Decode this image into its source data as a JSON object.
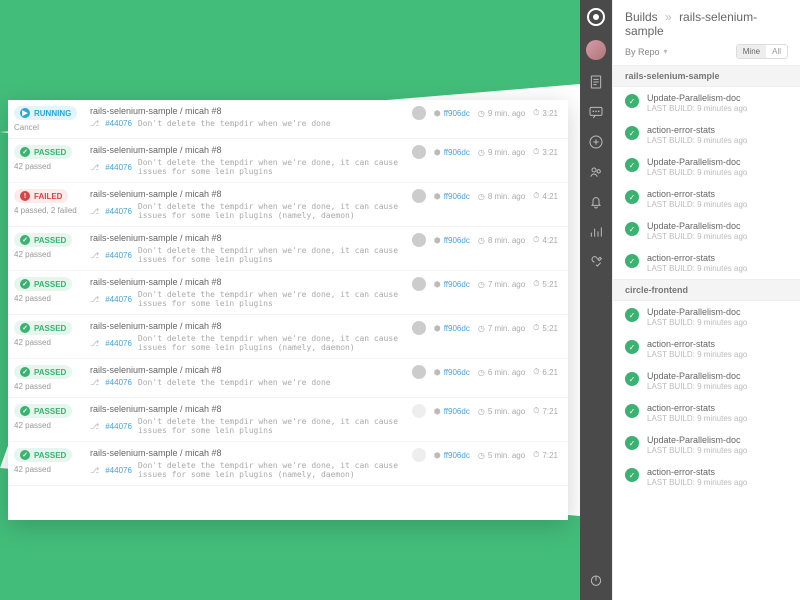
{
  "breadcrumb": {
    "root": "Builds",
    "repo": "rails-selenium-sample"
  },
  "filter": {
    "byRepo": "By Repo",
    "mine": "Mine",
    "all": "All"
  },
  "panel": {
    "groups": [
      {
        "name": "rails-selenium-sample",
        "items": [
          {
            "name": "Update-Parallelism-doc",
            "meta": "LAST BUILD: 9 minutes ago"
          },
          {
            "name": "action-error-stats",
            "meta": "LAST BUILD: 9 minutes ago"
          },
          {
            "name": "Update-Parallelism-doc",
            "meta": "LAST BUILD: 9 minutes ago"
          },
          {
            "name": "action-error-stats",
            "meta": "LAST BUILD: 9 minutes ago"
          },
          {
            "name": "Update-Parallelism-doc",
            "meta": "LAST BUILD: 9 minutes ago"
          },
          {
            "name": "action-error-stats",
            "meta": "LAST BUILD: 9 minutes ago"
          }
        ]
      },
      {
        "name": "circle-frontend",
        "items": [
          {
            "name": "Update-Parallelism-doc",
            "meta": "LAST BUILD: 9 minutes ago"
          },
          {
            "name": "action-error-stats",
            "meta": "LAST BUILD: 9 minutes ago"
          },
          {
            "name": "Update-Parallelism-doc",
            "meta": "LAST BUILD: 9 minutes ago"
          },
          {
            "name": "action-error-stats",
            "meta": "LAST BUILD: 9 minutes ago"
          },
          {
            "name": "Update-Parallelism-doc",
            "meta": "LAST BUILD: 9 minutes ago"
          },
          {
            "name": "action-error-stats",
            "meta": "LAST BUILD: 9 minutes ago"
          }
        ]
      }
    ]
  },
  "builds": [
    {
      "status": "RUNNING",
      "statusKind": "running",
      "sub": "Cancel",
      "subKind": "neutral",
      "title": "rails-selenium-sample / micah  #8",
      "commitId": "#44076",
      "commitMsg": "Don't delete the tempdir when we're done",
      "hash": "ff906dc",
      "time": "9 min. ago",
      "count": "3:21",
      "avatar": true
    },
    {
      "status": "PASSED",
      "statusKind": "passed",
      "sub": "42 passed",
      "title": "rails-selenium-sample / micah  #8",
      "commitId": "#44076",
      "commitMsg": "Don't delete the tempdir when we're done, it can cause issues for some lein plugins",
      "hash": "ff906dc",
      "time": "9 min. ago",
      "count": "3:21",
      "avatar": true
    },
    {
      "status": "FAILED",
      "statusKind": "failed",
      "sub": "4 passed, 2 failed",
      "title": "rails-selenium-sample / micah  #8",
      "commitId": "#44076",
      "commitMsg": "Don't delete the tempdir when we're done, it can cause issues for some lein plugins (namely, daemon)",
      "hash": "ff906dc",
      "time": "8 min. ago",
      "count": "4:21",
      "avatar": true
    },
    {
      "status": "PASSED",
      "statusKind": "passed",
      "sub": "42 passed",
      "title": "rails-selenium-sample / micah  #8",
      "commitId": "#44076",
      "commitMsg": "Don't delete the tempdir when we're done, it can cause issues for some lein plugins",
      "hash": "ff906dc",
      "time": "8 min. ago",
      "count": "4:21",
      "avatar": true
    },
    {
      "status": "PASSED",
      "statusKind": "passed",
      "sub": "42 passed",
      "title": "rails-selenium-sample / micah  #8",
      "commitId": "#44076",
      "commitMsg": "Don't delete the tempdir when we're done, it can cause issues for some lein plugins",
      "hash": "ff906dc",
      "time": "7 min. ago",
      "count": "5:21",
      "avatar": true
    },
    {
      "status": "PASSED",
      "statusKind": "passed",
      "sub": "42 passed",
      "title": "rails-selenium-sample / micah  #8",
      "commitId": "#44076",
      "commitMsg": "Don't delete the tempdir when we're done, it can cause issues for some lein plugins (namely, daemon)",
      "hash": "ff906dc",
      "time": "7 min. ago",
      "count": "5:21",
      "avatar": true
    },
    {
      "status": "PASSED",
      "statusKind": "passed",
      "sub": "42 passed",
      "title": "rails-selenium-sample / micah  #8",
      "commitId": "#44076",
      "commitMsg": "Don't delete the tempdir when we're done",
      "hash": "ff906dc",
      "time": "6 min. ago",
      "count": "6:21",
      "avatar": true
    },
    {
      "status": "PASSED",
      "statusKind": "passed",
      "sub": "42 passed",
      "title": "rails-selenium-sample / micah  #8",
      "commitId": "#44076",
      "commitMsg": "Don't delete the tempdir when we're done, it can cause issues for some lein plugins",
      "hash": "ff906dc",
      "time": "5 min. ago",
      "count": "7:21",
      "avatar": false
    },
    {
      "status": "PASSED",
      "statusKind": "passed",
      "sub": "42 passed",
      "title": "rails-selenium-sample / micah  #8",
      "commitId": "#44076",
      "commitMsg": "Don't delete the tempdir when we're done, it can cause issues for some lein plugins (namely, daemon)",
      "hash": "ff906dc",
      "time": "5 min. ago",
      "count": "7:21",
      "avatar": false
    }
  ]
}
